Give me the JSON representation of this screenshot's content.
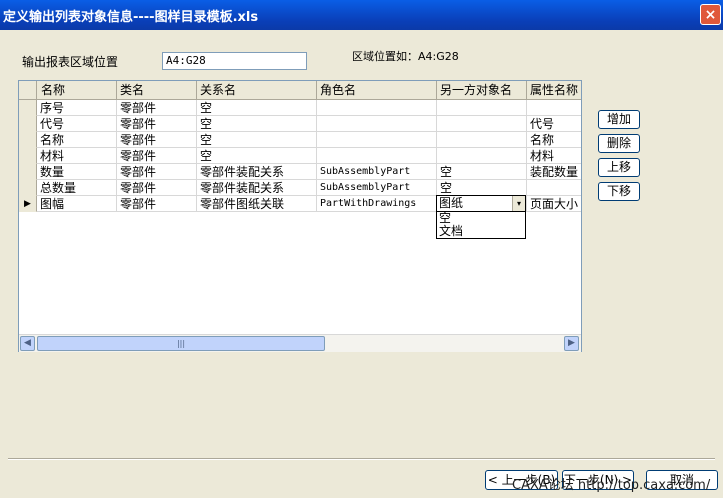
{
  "window": {
    "title": "定义输出列表对象信息----图样目录模板.xls",
    "close_label": "×"
  },
  "form": {
    "region_label": "输出报表区域位置",
    "region_value": "A4:G28",
    "region_hint": "区域位置如：A4:G28"
  },
  "table": {
    "columns": [
      "名称",
      "类名",
      "关系名",
      "角色名",
      "另一方对象名",
      "属性名称"
    ],
    "rows": [
      {
        "marker": "",
        "cells": [
          "序号",
          "零部件",
          "空",
          "",
          "",
          ""
        ]
      },
      {
        "marker": "",
        "cells": [
          "代号",
          "零部件",
          "空",
          "",
          "",
          "代号"
        ]
      },
      {
        "marker": "",
        "cells": [
          "名称",
          "零部件",
          "空",
          "",
          "",
          "名称"
        ]
      },
      {
        "marker": "",
        "cells": [
          "材料",
          "零部件",
          "空",
          "",
          "",
          "材料"
        ]
      },
      {
        "marker": "",
        "cells": [
          "数量",
          "零部件",
          "零部件装配关系",
          "SubAssemblyPart",
          "空",
          "装配数量"
        ]
      },
      {
        "marker": "",
        "cells": [
          "总数量",
          "零部件",
          "零部件装配关系",
          "SubAssemblyPart",
          "空",
          ""
        ]
      },
      {
        "marker": "▶",
        "cells": [
          "图幅",
          "零部件",
          "零部件图纸关联",
          "PartWithDrawings",
          "",
          "页面大小"
        ]
      }
    ],
    "active_combo": {
      "value": "图纸",
      "arrow": "▾",
      "options": [
        "空",
        "文档"
      ]
    }
  },
  "scrollbar": {
    "left_arrow": "◀",
    "right_arrow": "▶",
    "grip": "|||"
  },
  "side_buttons": {
    "add": "增加",
    "delete": "删除",
    "move_up": "上移",
    "move_down": "下移"
  },
  "footer": {
    "prev_label": "< 上一步(B)",
    "next_label": "下一步(N) >",
    "cancel_label": "取消",
    "watermark": "CAXA论坛 http://top.caxa.com/"
  }
}
